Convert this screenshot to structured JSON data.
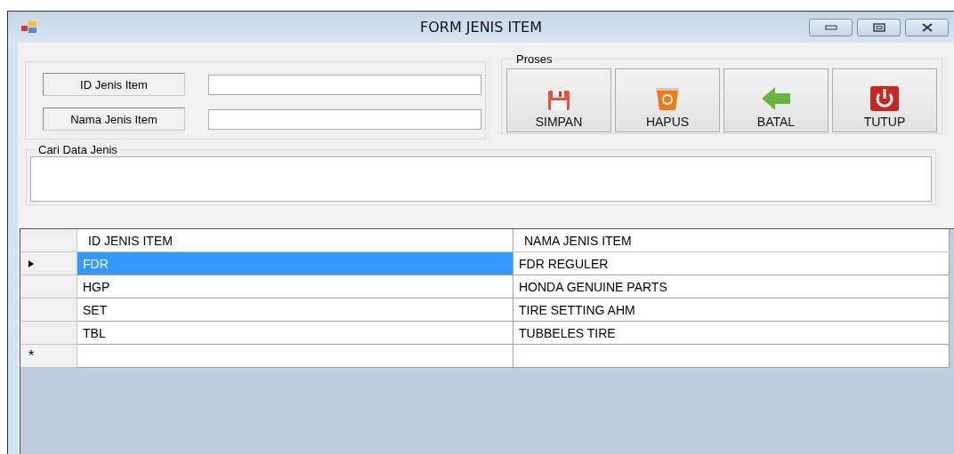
{
  "window": {
    "title": "FORM JENIS ITEM"
  },
  "fields": [
    {
      "label": "ID Jenis Item"
    },
    {
      "label": "Nama Jenis Item"
    }
  ],
  "proses": {
    "title": "Proses",
    "buttons": [
      {
        "label": "SIMPAN",
        "kind": "save"
      },
      {
        "label": "HAPUS",
        "kind": "delete"
      },
      {
        "label": "BATAL",
        "kind": "back"
      },
      {
        "label": "TUTUP",
        "kind": "power"
      }
    ]
  },
  "search": {
    "title": "Cari Data Jenis"
  },
  "table": {
    "columns": [
      "ID JENIS ITEM",
      "NAMA JENIS ITEM"
    ],
    "rows": [
      {
        "cells": [
          "FDR",
          "FDR REGULER"
        ],
        "selected": true
      },
      {
        "cells": [
          "HGP",
          "HONDA GENUINE PARTS"
        ],
        "selected": false
      },
      {
        "cells": [
          "SET",
          "TIRE SETTING AHM"
        ],
        "selected": false
      },
      {
        "cells": [
          "TBL",
          "TUBBELES TIRE"
        ],
        "selected": false
      }
    ],
    "new_row_marker": "*"
  }
}
